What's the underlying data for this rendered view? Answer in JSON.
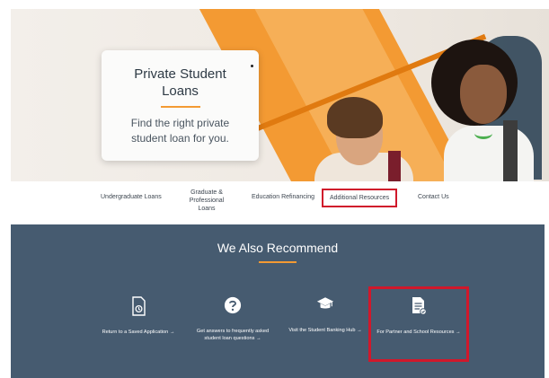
{
  "hero": {
    "title": "Private Student Loans",
    "subtitle": "Find the right private student loan for you."
  },
  "nav": {
    "items": [
      {
        "label": "Undergraduate Loans"
      },
      {
        "label": "Graduate & Professional Loans"
      },
      {
        "label": "Education Refinancing"
      },
      {
        "label": "Additional Resources"
      },
      {
        "label": "Contact Us"
      }
    ]
  },
  "recommend": {
    "title": "We Also Recommend",
    "items": [
      {
        "label": "Return to a Saved Application →",
        "icon": "saved-application-icon"
      },
      {
        "label": "Get answers to frequently asked student loan questions →",
        "icon": "question-icon"
      },
      {
        "label": "Visit the Student Banking Hub →",
        "icon": "graduation-cap-icon"
      },
      {
        "label": "For Partner and School Resources →",
        "icon": "document-icon"
      }
    ]
  },
  "colors": {
    "accent": "#f39a33",
    "highlight": "#d0182b",
    "panel": "#465b70"
  }
}
